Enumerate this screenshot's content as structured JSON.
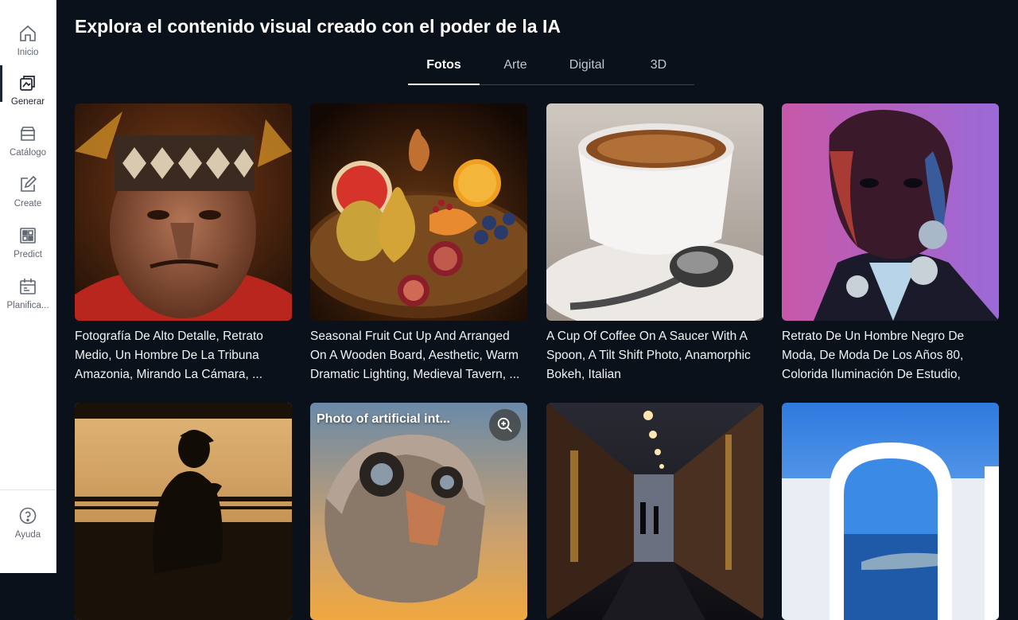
{
  "sidebar": {
    "items": [
      {
        "label": "Inicio",
        "icon": "home-icon"
      },
      {
        "label": "Generar",
        "icon": "generate-icon"
      },
      {
        "label": "Catálogo",
        "icon": "catalog-icon"
      },
      {
        "label": "Create",
        "icon": "create-icon"
      },
      {
        "label": "Predict",
        "icon": "predict-icon"
      },
      {
        "label": "Planifica...",
        "icon": "calendar-icon"
      }
    ],
    "help": {
      "label": "Ayuda",
      "icon": "help-icon"
    }
  },
  "header": {
    "title": "Explora el contenido visual creado con el poder de la IA"
  },
  "tabs": [
    {
      "label": "Fotos",
      "active": true
    },
    {
      "label": "Arte",
      "active": false
    },
    {
      "label": "Digital",
      "active": false
    },
    {
      "label": "3D",
      "active": false
    }
  ],
  "gallery": {
    "cards": [
      {
        "caption": "Fotografía De Alto Detalle, Retrato Medio, Un Hombre De La Tribuna Amazonia, Mirando La Cámara, ..."
      },
      {
        "caption": "Seasonal Fruit Cut Up And Arranged On A Wooden Board, Aesthetic, Warm Dramatic Lighting, Medieval Tavern, ..."
      },
      {
        "caption": "A Cup Of Coffee On A Saucer With A Spoon, A Tilt Shift Photo, Anamorphic Bokeh, Italian"
      },
      {
        "caption": "Retrato De Un Hombre Negro De Moda, De Moda De Los Años 80, Colorida Iluminación De Estudio,"
      },
      {
        "caption": ""
      },
      {
        "caption": "",
        "overlay_title": "Photo of artificial int..."
      },
      {
        "caption": ""
      },
      {
        "caption": ""
      }
    ]
  },
  "colors": {
    "background": "#0b111b",
    "sidebar": "#ffffff",
    "active_tab": "#ffffff"
  }
}
